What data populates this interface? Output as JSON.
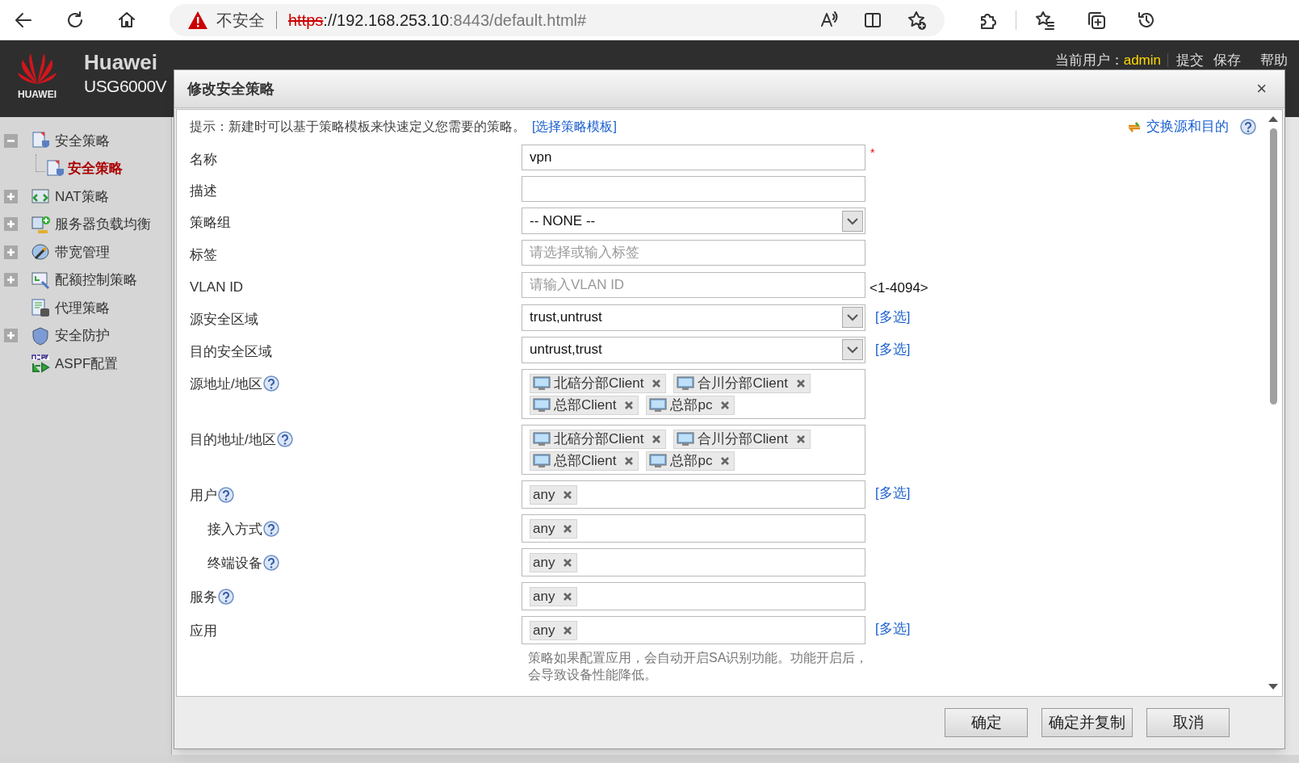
{
  "browser": {
    "security": "不安全",
    "url_scheme": "https",
    "url_host": "://192.168.253.10",
    "url_path": ":8443/default.html#"
  },
  "header": {
    "logo_text": "HUAWEI",
    "brand": "Huawei",
    "model": "USG6000V",
    "user_label": "当前用户：",
    "user": "admin",
    "links": [
      "提交",
      "保存",
      "帮助"
    ]
  },
  "sidebar": {
    "items": [
      {
        "label": "安全策略",
        "expandable": true,
        "expanded": true,
        "selected": false,
        "children": [
          {
            "label": "安全策略",
            "selected": true
          }
        ]
      },
      {
        "label": "NAT策略",
        "expandable": true,
        "expanded": false,
        "selected": false
      },
      {
        "label": "服务器负载均衡",
        "expandable": true,
        "expanded": false,
        "selected": false
      },
      {
        "label": "带宽管理",
        "expandable": true,
        "expanded": false,
        "selected": false
      },
      {
        "label": "配额控制策略",
        "expandable": true,
        "expanded": false,
        "selected": false
      },
      {
        "label": "代理策略",
        "expandable": false,
        "selected": false
      },
      {
        "label": "安全防护",
        "expandable": true,
        "expanded": false,
        "selected": false
      },
      {
        "label": "ASPF配置",
        "expandable": false,
        "selected": false
      }
    ]
  },
  "dialog": {
    "title": "修改安全策略",
    "close": "×",
    "hint": "提示：新建时可以基于策略模板来快速定义您需要的策略。",
    "hint_link": "[选择策略模板]",
    "swap_link": "交换源和目的",
    "fields": [
      {
        "kind": "text",
        "label": "名称",
        "value": "vpn",
        "required_mark": "*"
      },
      {
        "kind": "text",
        "label": "描述"
      },
      {
        "kind": "select",
        "label": "策略组",
        "value": "-- NONE --"
      },
      {
        "kind": "text",
        "label": "标签",
        "placeholder": "请选择或输入标签"
      },
      {
        "kind": "text",
        "label": "VLAN ID",
        "placeholder": "请输入VLAN ID",
        "suffix": "<1-4094>"
      },
      {
        "kind": "select",
        "label": "源安全区域",
        "value": "trust,untrust",
        "link": "[多选]"
      },
      {
        "kind": "select",
        "label": "目的安全区域",
        "value": "untrust,trust",
        "link": "[多选]"
      },
      {
        "kind": "tags",
        "label": "源地址/地区",
        "help": true,
        "tags": [
          {
            "text": "北碚分部Client",
            "icon": true
          },
          {
            "text": "合川分部Client",
            "icon": true
          },
          {
            "text": "总部Client",
            "icon": true
          },
          {
            "text": "总部pc",
            "icon": true
          }
        ]
      },
      {
        "kind": "tags",
        "label": "目的地址/地区",
        "help": true,
        "tags": [
          {
            "text": "北碚分部Client",
            "icon": true
          },
          {
            "text": "合川分部Client",
            "icon": true
          },
          {
            "text": "总部Client",
            "icon": true
          },
          {
            "text": "总部pc",
            "icon": true
          }
        ]
      },
      {
        "kind": "tags",
        "label": "用户",
        "help": true,
        "tags": [
          {
            "text": "any",
            "icon": false
          }
        ],
        "link": "[多选]"
      },
      {
        "kind": "tags",
        "label": "接入方式",
        "help": true,
        "indent": true,
        "tags": [
          {
            "text": "any",
            "icon": false
          }
        ]
      },
      {
        "kind": "tags",
        "label": "终端设备",
        "help": true,
        "indent": true,
        "tags": [
          {
            "text": "any",
            "icon": false
          }
        ]
      },
      {
        "kind": "tags",
        "label": "服务",
        "help": true,
        "tags": [
          {
            "text": "any",
            "icon": false
          }
        ]
      },
      {
        "kind": "tags",
        "label": "应用",
        "tags": [
          {
            "text": "any",
            "icon": false
          }
        ],
        "link": "[多选]"
      },
      {
        "kind": "note",
        "text": "策略如果配置应用，会自动开启SA识别功能。功能开启后，会导致设备性能降低。"
      }
    ],
    "buttons": [
      "确定",
      "确定并复制",
      "取消"
    ]
  }
}
